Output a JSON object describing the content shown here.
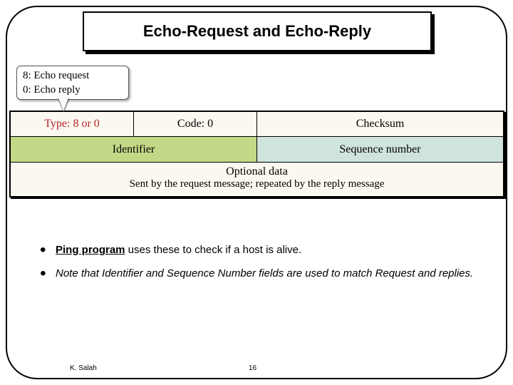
{
  "title": "Echo-Request and Echo-Reply",
  "callout": {
    "line1": "8: Echo request",
    "line2": "0: Echo reply"
  },
  "packet": {
    "row1": {
      "type": "Type: 8 or 0",
      "code": "Code: 0",
      "checksum": "Checksum"
    },
    "row2": {
      "identifier": "Identifier",
      "sequence": "Sequence number"
    },
    "row3": {
      "title": "Optional data",
      "sub": "Sent by the request message; repeated by the reply message"
    }
  },
  "bullets": {
    "b1_strong": "Ping program",
    "b1_rest": " uses these to check if a host is alive.",
    "b2": "Note that Identifier and Sequence Number fields are used to match Request and replies."
  },
  "footer": {
    "author": "K. Salah",
    "page": "16"
  }
}
